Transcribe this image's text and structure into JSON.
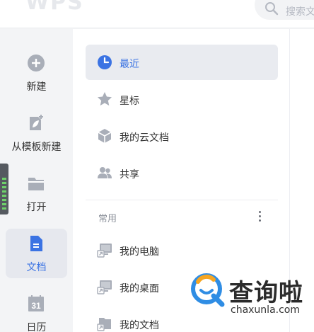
{
  "header": {
    "logo": "WPS",
    "search_placeholder": "搜索文"
  },
  "rail": {
    "items": [
      {
        "label": "新建",
        "icon": "plus-circle-icon"
      },
      {
        "label": "从模板新建",
        "icon": "template-icon"
      },
      {
        "label": "打开",
        "icon": "folder-icon"
      },
      {
        "label": "文档",
        "icon": "document-icon",
        "active": true
      },
      {
        "label": "日历",
        "icon": "calendar-icon",
        "calendar_day": "31"
      }
    ]
  },
  "nav": {
    "items": [
      {
        "label": "最近",
        "icon": "clock-icon",
        "active": true
      },
      {
        "label": "星标",
        "icon": "star-icon"
      },
      {
        "label": "我的云文档",
        "icon": "cloud-box-icon"
      },
      {
        "label": "共享",
        "icon": "users-icon"
      }
    ],
    "common_section": {
      "label": "常用",
      "items": [
        {
          "label": "我的电脑",
          "icon": "computer-shortcut-icon"
        },
        {
          "label": "我的桌面",
          "icon": "desktop-shortcut-icon"
        },
        {
          "label": "我的文档",
          "icon": "documents-shortcut-icon"
        }
      ]
    }
  },
  "watermark": {
    "title": "查询啦",
    "url": "chaxunla.com"
  },
  "colors": {
    "accent": "#3b73e3",
    "icon_gray": "#a9aeb8",
    "active_bg": "#e6e8ee"
  }
}
